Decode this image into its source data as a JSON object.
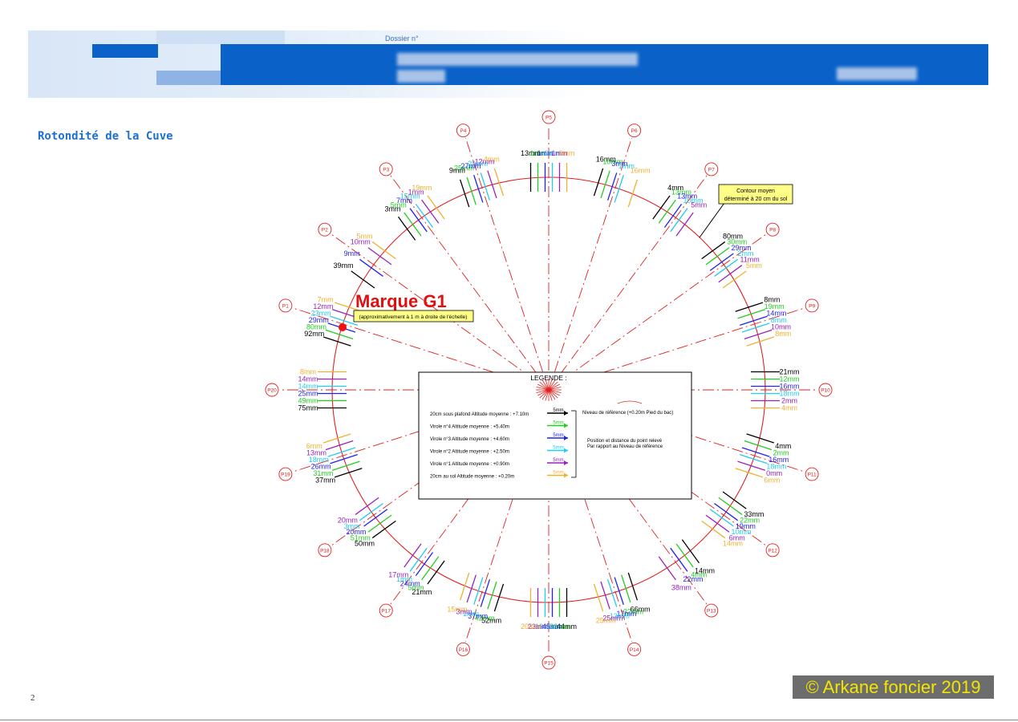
{
  "header": {
    "dossier_label": "Dossier n°",
    "colors": {
      "bar": "#0a62c9",
      "light": "#d8e6f7"
    }
  },
  "page_title": "Rotondité de la Cuve",
  "marque": {
    "label": "Marque G1",
    "note": "(approximativement à 1 m à droite de l'échelle)"
  },
  "contour_note": "Contour moyen déterminé à 20 cm du sol",
  "legend": {
    "title": "LEGENDE :",
    "levels": [
      {
        "label": "20cm sous plafond Altitude moyenne : +7.10m",
        "sample": "5mm",
        "color": "#000000"
      },
      {
        "label": "Virole n°4 Altitude moyenne : +5.40m",
        "sample": "5mm",
        "color": "#22cc22"
      },
      {
        "label": "Virole n°3 Altitude moyenne : +4.60m",
        "sample": "5mm",
        "color": "#2222ee"
      },
      {
        "label": "Virole n°2 Altitude moyenne : +2.50m",
        "sample": "5mm",
        "color": "#22ccee"
      },
      {
        "label": "Virole n°1 Altitude moyenne : +0.90m",
        "sample": "5mm",
        "color": "#9922bb"
      },
      {
        "label": "20cm au sol Altitude moyenne : +0.20m",
        "sample": "5mm",
        "color": "#f0b030"
      }
    ],
    "reference_note": "Niveau de référence (+0.20m Pied du bac)",
    "position_note_1": "Position et distance du point relevé",
    "position_note_2": "Par rapport au Niveau de référence"
  },
  "points": [
    {
      "id": "P1",
      "values": [
        "92mm",
        "80mm",
        "29mm",
        "23mm",
        "12mm",
        "7mm"
      ]
    },
    {
      "id": "P2",
      "values": [
        "39mm",
        "",
        "9mm",
        "",
        "10mm",
        "5mm"
      ]
    },
    {
      "id": "P3",
      "values": [
        "3mm",
        "5mm",
        "7mm",
        "15mm",
        "1mm",
        "19mm"
      ]
    },
    {
      "id": "P4",
      "values": [
        "9mm",
        "25mm",
        "27mm",
        "20mm",
        "12mm",
        "4mm"
      ]
    },
    {
      "id": "P5",
      "values": [
        "13mm",
        "1mm",
        "1mm",
        "0mm",
        "1mm",
        "9mm"
      ]
    },
    {
      "id": "P6",
      "values": [
        "16mm",
        "10mm",
        "3mm",
        "1mm",
        "",
        "16mm"
      ]
    },
    {
      "id": "P7",
      "values": [
        "4mm",
        "13mm",
        "13mm",
        "10mm",
        "5mm",
        ""
      ]
    },
    {
      "id": "P8",
      "values": [
        "80mm",
        "30mm",
        "29mm",
        "2mm",
        "11mm",
        "5mm"
      ]
    },
    {
      "id": "P9",
      "values": [
        "8mm",
        "19mm",
        "14mm",
        "8mm",
        "10mm",
        "8mm"
      ]
    },
    {
      "id": "P10",
      "values": [
        "21mm",
        "12mm",
        "16mm",
        "18mm",
        "2mm",
        "4mm"
      ]
    },
    {
      "id": "P11",
      "values": [
        "4mm",
        "2mm",
        "16mm",
        "18mm",
        "0mm",
        "6mm"
      ]
    },
    {
      "id": "P12",
      "values": [
        "33mm",
        "22mm",
        "19mm",
        "10mm",
        "6mm",
        "14mm"
      ]
    },
    {
      "id": "P13",
      "values": [
        "14mm",
        "4mm",
        "22mm",
        "",
        "38mm",
        ""
      ]
    },
    {
      "id": "P14",
      "values": [
        "66mm",
        "32mm",
        "17mm",
        "13mm",
        "25mm",
        "25mm"
      ]
    },
    {
      "id": "P15",
      "values": [
        "44mm",
        "32mm",
        "45mm",
        "19mm",
        "23mm",
        "20mm"
      ]
    },
    {
      "id": "P16",
      "values": [
        "52mm",
        "42mm",
        "37mm",
        "1mm",
        "3mm",
        "15mm"
      ]
    },
    {
      "id": "P17",
      "values": [
        "21mm",
        "5mm",
        "24mm",
        "1mm",
        "17mm",
        ""
      ]
    },
    {
      "id": "P18",
      "values": [
        "50mm",
        "51mm",
        "20mm",
        "3mm",
        "20mm",
        ""
      ]
    },
    {
      "id": "P19",
      "values": [
        "37mm",
        "31mm",
        "26mm",
        "18mm",
        "13mm",
        "6mm"
      ]
    },
    {
      "id": "P20",
      "values": [
        "75mm",
        "49mm",
        "25mm",
        "14mm",
        "14mm",
        "8mm"
      ]
    }
  ],
  "page_number": "2",
  "copyright": "© Arkane foncier 2019"
}
